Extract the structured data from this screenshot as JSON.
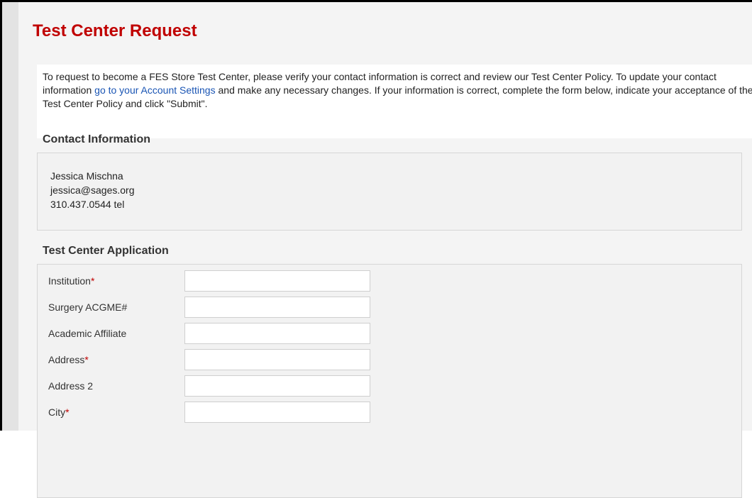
{
  "page": {
    "title": "Test Center Request",
    "intro_before_link": "To request to become a FES Store Test Center, please verify your contact information is correct and review our Test Center Policy. To update your contact information ",
    "intro_link": "go to your Account Settings",
    "intro_after_link": " and make any necessary changes. If your information is correct, complete the form below, indicate your acceptance of the Test Center Policy and click \"Submit\"."
  },
  "contact": {
    "heading": "Contact Information",
    "name": "Jessica Mischna",
    "email": "jessica@sages.org",
    "phone": "310.437.0544 tel"
  },
  "application": {
    "heading": "Test Center Application",
    "required_marker": "*",
    "fields": [
      {
        "label": "Institution",
        "required": true,
        "value": ""
      },
      {
        "label": "Surgery ACGME#",
        "required": false,
        "value": ""
      },
      {
        "label": "Academic Affiliate",
        "required": false,
        "value": ""
      },
      {
        "label": "Address",
        "required": true,
        "value": ""
      },
      {
        "label": "Address 2",
        "required": false,
        "value": ""
      },
      {
        "label": "City",
        "required": true,
        "value": ""
      }
    ]
  },
  "colors": {
    "title_red": "#c00000",
    "link_blue": "#1a55b4",
    "panel_gray": "#f2f2f2"
  }
}
